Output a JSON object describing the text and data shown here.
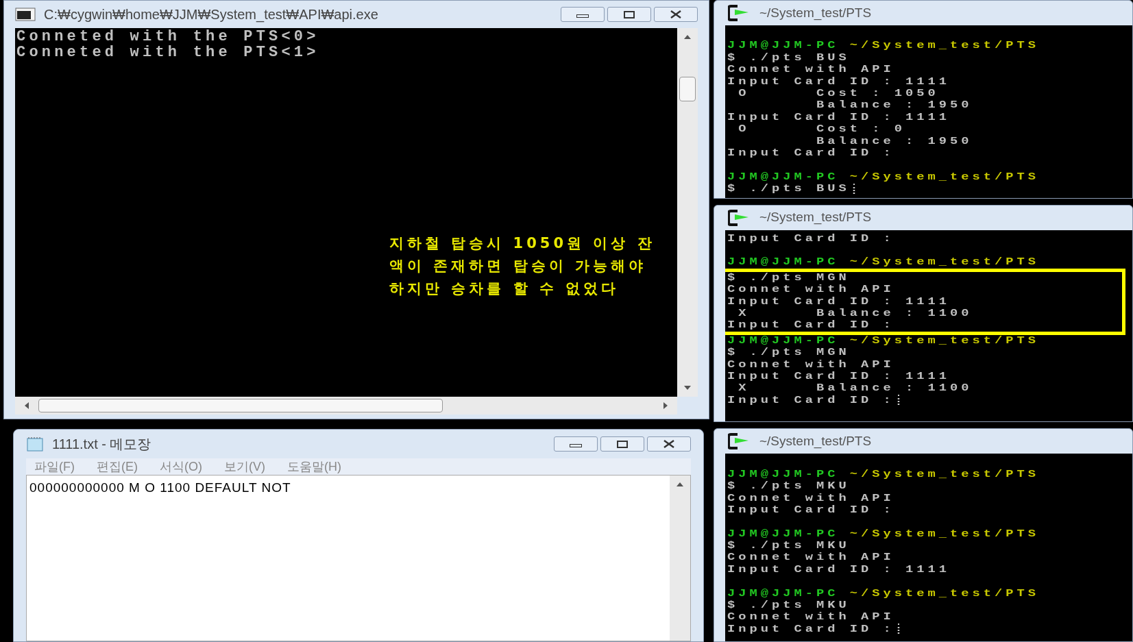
{
  "api_window": {
    "title": "C:₩cygwin₩home₩JJM₩System_test₩API₩api.exe",
    "lines": [
      "Conneted with the PTS<0>",
      "Conneted with the PTS<1>"
    ],
    "note": [
      "지하철 탑승시 1050원 이상 잔",
      "액이 존재하면 탑승이 가능해야",
      "하지만 승차를 할 수 없었다"
    ]
  },
  "notepad": {
    "title": "1111.txt - 메모장",
    "menu": [
      "파일(F)",
      "편집(E)",
      "서식(O)",
      "보기(V)",
      "도움말(H)"
    ],
    "content": "000000000000 M O 1100 DEFAULT NOT"
  },
  "terminals": [
    {
      "title": "~/System_test/PTS",
      "lines": [
        {
          "kind": "blank"
        },
        {
          "kind": "prompt",
          "user": "JJM@JJM-PC",
          "path": "~/System_test/PTS"
        },
        {
          "kind": "text",
          "text": "$ ./pts BUS"
        },
        {
          "kind": "text",
          "text": "Connet with API"
        },
        {
          "kind": "text",
          "text": "Input Card ID : 1111"
        },
        {
          "kind": "text",
          "text": " O      Cost : 1050"
        },
        {
          "kind": "text",
          "text": "        Balance : 1950"
        },
        {
          "kind": "text",
          "text": "Input Card ID : 1111"
        },
        {
          "kind": "text",
          "text": " O      Cost : 0"
        },
        {
          "kind": "text",
          "text": "        Balance : 1950"
        },
        {
          "kind": "text",
          "text": "Input Card ID :"
        },
        {
          "kind": "blank"
        },
        {
          "kind": "prompt",
          "user": "JJM@JJM-PC",
          "path": "~/System_test/PTS"
        },
        {
          "kind": "text",
          "text": "$ ./pts BUS",
          "cursor": true
        }
      ]
    },
    {
      "title": "~/System_test/PTS",
      "lines": [
        {
          "kind": "text",
          "text": "Input Card ID :"
        },
        {
          "kind": "blank"
        },
        {
          "kind": "prompt",
          "user": "JJM@JJM-PC",
          "path": "~/System_test/PTS"
        },
        {
          "kind": "text",
          "text": "$ ./pts MGN",
          "highlighted": true
        },
        {
          "kind": "text",
          "text": "Connet with API",
          "highlighted": true
        },
        {
          "kind": "text",
          "text": "Input Card ID : 1111",
          "highlighted": true
        },
        {
          "kind": "text",
          "text": " X      Balance : 1100",
          "highlighted": true
        },
        {
          "kind": "text",
          "text": "Input Card ID :",
          "highlighted": true
        },
        {
          "kind": "prompt",
          "user": "JJM@JJM-PC",
          "path": "~/System_test/PTS"
        },
        {
          "kind": "text",
          "text": "$ ./pts MGN"
        },
        {
          "kind": "text",
          "text": "Connet with API"
        },
        {
          "kind": "text",
          "text": "Input Card ID : 1111"
        },
        {
          "kind": "text",
          "text": " X      Balance : 1100"
        },
        {
          "kind": "text",
          "text": "Input Card ID :",
          "cursor": true
        }
      ]
    },
    {
      "title": "~/System_test/PTS",
      "lines": [
        {
          "kind": "blank"
        },
        {
          "kind": "prompt",
          "user": "JJM@JJM-PC",
          "path": "~/System_test/PTS"
        },
        {
          "kind": "text",
          "text": "$ ./pts MKU"
        },
        {
          "kind": "text",
          "text": "Connet with API"
        },
        {
          "kind": "text",
          "text": "Input Card ID :"
        },
        {
          "kind": "blank"
        },
        {
          "kind": "prompt",
          "user": "JJM@JJM-PC",
          "path": "~/System_test/PTS"
        },
        {
          "kind": "text",
          "text": "$ ./pts MKU"
        },
        {
          "kind": "text",
          "text": "Connet with API"
        },
        {
          "kind": "text",
          "text": "Input Card ID : 1111"
        },
        {
          "kind": "blank"
        },
        {
          "kind": "prompt",
          "user": "JJM@JJM-PC",
          "path": "~/System_test/PTS"
        },
        {
          "kind": "text",
          "text": "$ ./pts MKU"
        },
        {
          "kind": "text",
          "text": "Connet with API"
        },
        {
          "kind": "text",
          "text": "Input Card ID :",
          "cursor": true
        }
      ]
    }
  ]
}
